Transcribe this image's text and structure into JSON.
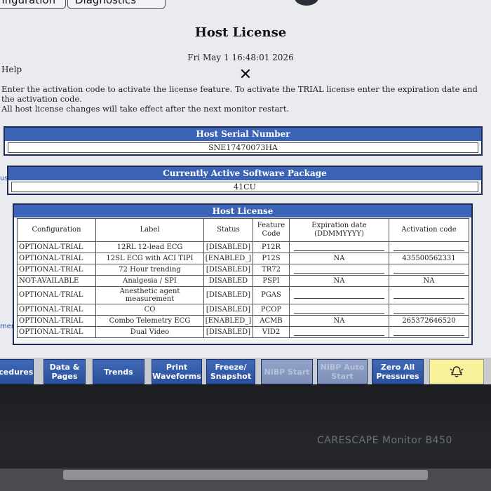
{
  "tabs": {
    "configuration": "nfiguration",
    "diagnostics": "Diagnostics"
  },
  "title": "Host License",
  "datetime": "Fri May 1 16:48:01 2026",
  "close_symbol": "✕",
  "help": "Help",
  "instructions": {
    "line1": "Enter the activation code to activate the license feature. To activate the TRIAL license enter the expiration date and the activation code.",
    "line2": "All host license changes will take effect after the next monitor restart."
  },
  "side_labels": {
    "s": "us",
    "ment": "ment"
  },
  "serial": {
    "header": "Host Serial Number",
    "value": "SNE17470073HA"
  },
  "package": {
    "header": "Currently Active Software Package",
    "value": "41CU"
  },
  "license": {
    "header": "Host License",
    "columns": [
      "Configuration",
      "Label",
      "Status",
      "Feature Code",
      "Expiration date (DDMMYYYY)",
      "Activation code"
    ],
    "rows": [
      {
        "cfg": "OPTIONAL-TRIAL",
        "label": "12RL 12-lead ECG",
        "status": "[DISABLED]",
        "code": "P12R",
        "exp": "",
        "act": ""
      },
      {
        "cfg": "OPTIONAL-TRIAL",
        "label": "12SL ECG with ACI TIPI",
        "status": "[ENABLED_]",
        "code": "P12S",
        "exp": "NA",
        "act": "435500562331"
      },
      {
        "cfg": "OPTIONAL-TRIAL",
        "label": "72 Hour trending",
        "status": "[DISABLED]",
        "code": "TR72",
        "exp": "",
        "act": ""
      },
      {
        "cfg": "NOT-AVAILABLE",
        "label": "Analgesia / SPI",
        "status": "DISABLED",
        "code": "PSPI",
        "exp": "NA",
        "act": "NA"
      },
      {
        "cfg": "OPTIONAL-TRIAL",
        "label": "Anesthetic agent measurement",
        "status": "[DISABLED]",
        "code": "PGAS",
        "exp": "",
        "act": ""
      },
      {
        "cfg": "OPTIONAL-TRIAL",
        "label": "CO",
        "status": "[DISABLED]",
        "code": "PCOP",
        "exp": "",
        "act": ""
      },
      {
        "cfg": "OPTIONAL-TRIAL",
        "label": "Combo Telemetry ECG",
        "status": "[ENABLED_]",
        "code": "ACMB",
        "exp": "NA",
        "act": "265372646520"
      },
      {
        "cfg": "OPTIONAL-TRIAL",
        "label": "Dual Video",
        "status": "[DISABLED]",
        "code": "VID2",
        "exp": "",
        "act": ""
      }
    ]
  },
  "softkeys": {
    "procedures": "ocedures",
    "data_pages": "Data & Pages",
    "trends": "Trends",
    "print_waveforms": "Print Waveforms",
    "freeze_snapshot": "Freeze/ Snapshot",
    "nibp_start": "NIBP Start",
    "nibp_auto_start": "NIBP Auto Start",
    "zero_all": "Zero All Pressures",
    "alarm_icon": "alarm-bell-icon"
  },
  "brand": "CARESCAPE Monitor B450"
}
